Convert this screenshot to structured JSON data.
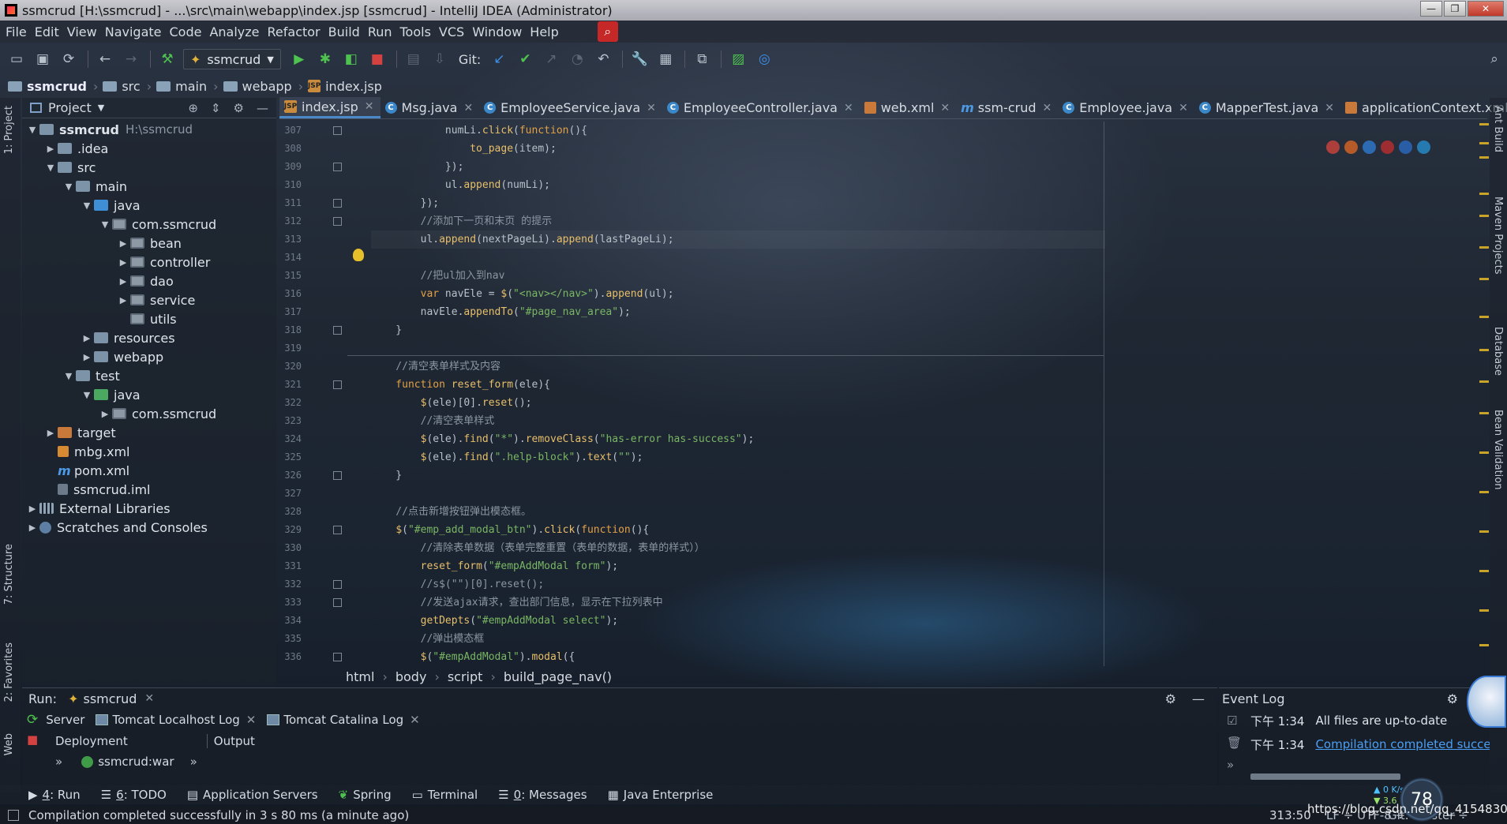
{
  "window": {
    "title": "ssmcrud [H:\\ssmcrud] - ...\\src\\main\\webapp\\index.jsp [ssmcrud] - IntelliJ IDEA (Administrator)",
    "minimize": "—",
    "maximize": "❐",
    "close": "✕"
  },
  "menu": [
    "File",
    "Edit",
    "View",
    "Navigate",
    "Code",
    "Analyze",
    "Refactor",
    "Build",
    "Run",
    "Tools",
    "VCS",
    "Window",
    "Help"
  ],
  "toolbar": {
    "run_config": "ssmcrud",
    "git_label": "Git:"
  },
  "breadcrumb": [
    "ssmcrud",
    "src",
    "main",
    "webapp",
    "index.jsp"
  ],
  "left_stripe": {
    "project": "1: Project",
    "structure": "7: Structure",
    "favorites": "2: Favorites",
    "web": "Web"
  },
  "right_stripe": {
    "ant": "Ant Build",
    "maven": "Maven Projects",
    "database": "Database",
    "bean": "Bean Validation"
  },
  "project_panel": {
    "title": "Project",
    "tree": [
      {
        "label": "ssmcrud",
        "extra": "H:\\ssmcrud",
        "level": 0,
        "arrow": "▼",
        "icon": "folder"
      },
      {
        "label": ".idea",
        "level": 1,
        "arrow": "▶",
        "icon": "folder"
      },
      {
        "label": "src",
        "level": 1,
        "arrow": "▼",
        "icon": "folder"
      },
      {
        "label": "main",
        "level": 2,
        "arrow": "▼",
        "icon": "folder"
      },
      {
        "label": "java",
        "level": 3,
        "arrow": "▼",
        "icon": "folder-blue"
      },
      {
        "label": "com.ssmcrud",
        "level": 4,
        "arrow": "▼",
        "icon": "pkg"
      },
      {
        "label": "bean",
        "level": 5,
        "arrow": "▶",
        "icon": "pkg"
      },
      {
        "label": "controller",
        "level": 5,
        "arrow": "▶",
        "icon": "pkg"
      },
      {
        "label": "dao",
        "level": 5,
        "arrow": "▶",
        "icon": "pkg"
      },
      {
        "label": "service",
        "level": 5,
        "arrow": "▶",
        "icon": "pkg"
      },
      {
        "label": "utils",
        "level": 5,
        "arrow": "",
        "icon": "pkg"
      },
      {
        "label": "resources",
        "level": 3,
        "arrow": "▶",
        "icon": "folder"
      },
      {
        "label": "webapp",
        "level": 3,
        "arrow": "▶",
        "icon": "folder"
      },
      {
        "label": "test",
        "level": 2,
        "arrow": "▼",
        "icon": "folder"
      },
      {
        "label": "java",
        "level": 3,
        "arrow": "▼",
        "icon": "folder-green"
      },
      {
        "label": "com.ssmcrud",
        "level": 4,
        "arrow": "▶",
        "icon": "pkg"
      },
      {
        "label": "target",
        "level": 1,
        "arrow": "▶",
        "icon": "folder-orange"
      },
      {
        "label": "mbg.xml",
        "level": 1,
        "arrow": "",
        "icon": "xml"
      },
      {
        "label": "pom.xml",
        "level": 1,
        "arrow": "",
        "icon": "mvn"
      },
      {
        "label": "ssmcrud.iml",
        "level": 1,
        "arrow": "",
        "icon": "iml"
      },
      {
        "label": "External Libraries",
        "level": 0,
        "arrow": "▶",
        "icon": "libs"
      },
      {
        "label": "Scratches and Consoles",
        "level": 0,
        "arrow": "▶",
        "icon": "scratch"
      }
    ]
  },
  "editor_tabs": [
    {
      "label": "index.jsp",
      "icon": "jsp",
      "active": true
    },
    {
      "label": "Msg.java",
      "icon": "c"
    },
    {
      "label": "EmployeeService.java",
      "icon": "c"
    },
    {
      "label": "EmployeeController.java",
      "icon": "c"
    },
    {
      "label": "web.xml",
      "icon": "x"
    },
    {
      "label": "ssm-crud",
      "icon": "m"
    },
    {
      "label": "Employee.java",
      "icon": "c"
    },
    {
      "label": "MapperTest.java",
      "icon": "c"
    },
    {
      "label": "applicationContext.xml",
      "icon": "x"
    }
  ],
  "code": {
    "first_line": 307,
    "current_line": 313,
    "lines": [
      [
        [
          "",
          "            numLi."
        ],
        [
          "fn",
          "click"
        ],
        [
          "",
          "("
        ],
        [
          "kw",
          "function"
        ],
        [
          "",
          "(){"
        ]
      ],
      [
        [
          "",
          "                "
        ],
        [
          "fn",
          "to_page"
        ],
        [
          "",
          "(item);"
        ]
      ],
      [
        [
          "",
          "            });"
        ]
      ],
      [
        [
          "",
          "            ul."
        ],
        [
          "fn",
          "append"
        ],
        [
          "",
          "(numLi);"
        ]
      ],
      [
        [
          "",
          "        });"
        ]
      ],
      [
        [
          "cm",
          "        //添加下一页和末页 的提示"
        ]
      ],
      [
        [
          "",
          "        ul."
        ],
        [
          "fn",
          "append"
        ],
        [
          "",
          "(nextPageLi)."
        ],
        [
          "fn",
          "append"
        ],
        [
          "",
          "(lastPageLi);"
        ]
      ],
      [
        [
          "",
          ""
        ]
      ],
      [
        [
          "cm",
          "        //把ul加入到nav"
        ]
      ],
      [
        [
          "",
          "        "
        ],
        [
          "kw",
          "var"
        ],
        [
          "",
          " navEle = "
        ],
        [
          "fn",
          "$"
        ],
        [
          "",
          "("
        ],
        [
          "str",
          "\"<nav></nav>\""
        ],
        [
          "",
          ")."
        ],
        [
          "fn",
          "append"
        ],
        [
          "",
          "(ul);"
        ]
      ],
      [
        [
          "",
          "        navEle."
        ],
        [
          "fn",
          "appendTo"
        ],
        [
          "",
          "("
        ],
        [
          "str",
          "\"#page_nav_area\""
        ],
        [
          "",
          ");"
        ]
      ],
      [
        [
          "",
          "    }"
        ]
      ],
      [
        [
          "",
          ""
        ]
      ],
      [
        [
          "cm",
          "    //清空表单样式及内容"
        ]
      ],
      [
        [
          "kw",
          "    function"
        ],
        [
          "",
          " "
        ],
        [
          "fn",
          "reset_form"
        ],
        [
          "",
          "(ele){"
        ]
      ],
      [
        [
          "",
          "        "
        ],
        [
          "fn",
          "$"
        ],
        [
          "",
          "(ele)[0]."
        ],
        [
          "fn",
          "reset"
        ],
        [
          "",
          "();"
        ]
      ],
      [
        [
          "cm",
          "        //清空表单样式"
        ]
      ],
      [
        [
          "",
          "        "
        ],
        [
          "fn",
          "$"
        ],
        [
          "",
          "(ele)."
        ],
        [
          "fn",
          "find"
        ],
        [
          "",
          "("
        ],
        [
          "str",
          "\"*\""
        ],
        [
          "",
          ")."
        ],
        [
          "fn",
          "removeClass"
        ],
        [
          "",
          "("
        ],
        [
          "str",
          "\"has-error has-success\""
        ],
        [
          "",
          ");"
        ]
      ],
      [
        [
          "",
          "        "
        ],
        [
          "fn",
          "$"
        ],
        [
          "",
          "(ele)."
        ],
        [
          "fn",
          "find"
        ],
        [
          "",
          "("
        ],
        [
          "str",
          "\".help-block\""
        ],
        [
          "",
          ")."
        ],
        [
          "fn",
          "text"
        ],
        [
          "",
          "("
        ],
        [
          "str",
          "\"\""
        ],
        [
          "",
          ");"
        ]
      ],
      [
        [
          "",
          "    }"
        ]
      ],
      [
        [
          "",
          ""
        ]
      ],
      [
        [
          "cm",
          "    //点击新增按钮弹出模态框。"
        ]
      ],
      [
        [
          "",
          "    "
        ],
        [
          "fn",
          "$"
        ],
        [
          "",
          "("
        ],
        [
          "str",
          "\"#emp_add_modal_btn\""
        ],
        [
          "",
          ")."
        ],
        [
          "fn",
          "click"
        ],
        [
          "",
          "("
        ],
        [
          "kw",
          "function"
        ],
        [
          "",
          "(){"
        ]
      ],
      [
        [
          "cm",
          "        //清除表单数据（表单完整重置（表单的数据，表单的样式））"
        ]
      ],
      [
        [
          "",
          "        "
        ],
        [
          "fn",
          "reset_form"
        ],
        [
          "",
          "("
        ],
        [
          "str",
          "\"#empAddModal form\""
        ],
        [
          "",
          ");"
        ]
      ],
      [
        [
          "cm",
          "        //s$(\"\")[0].reset();"
        ]
      ],
      [
        [
          "cm",
          "        //发送ajax请求，查出部门信息，显示在下拉列表中"
        ]
      ],
      [
        [
          "",
          "        "
        ],
        [
          "fn",
          "getDepts"
        ],
        [
          "",
          "("
        ],
        [
          "str",
          "\"#empAddModal select\""
        ],
        [
          "",
          ");"
        ]
      ],
      [
        [
          "cm",
          "        //弹出模态框"
        ]
      ],
      [
        [
          "",
          "        "
        ],
        [
          "fn",
          "$"
        ],
        [
          "",
          "("
        ],
        [
          "str",
          "\"#empAddModal\""
        ],
        [
          "",
          ")."
        ],
        [
          "fn",
          "modal"
        ],
        [
          "",
          "({"
        ]
      ]
    ]
  },
  "editor_breadcrumb": [
    "html",
    "body",
    "script",
    "build_page_nav()"
  ],
  "run_panel": {
    "title": "Run:",
    "config": "ssmcrud",
    "tabs": [
      "Server",
      "Tomcat Localhost Log",
      "Tomcat Catalina Log"
    ],
    "col_deployment": "Deployment",
    "col_output": "Output",
    "artifact": "ssmcrud:war"
  },
  "event_log": {
    "title": "Event Log",
    "entries": [
      {
        "time": "下午 1:34",
        "message": "All files are up-to-date",
        "link": false
      },
      {
        "time": "下午 1:34",
        "message": "Compilation completed succe",
        "link": true
      }
    ]
  },
  "tool_windows": [
    {
      "num": "4",
      "label": ": Run"
    },
    {
      "num": "6",
      "label": ": TODO"
    },
    {
      "num": "",
      "label": "Application Servers"
    },
    {
      "num": "",
      "label": "Spring"
    },
    {
      "num": "",
      "label": "Terminal"
    },
    {
      "num": "0",
      "label": ": Messages"
    },
    {
      "num": "",
      "label": "Java Enterprise"
    }
  ],
  "status": {
    "message": "Compilation completed successfully in 3 s 80 ms (a minute ago)",
    "position": "313:50",
    "encoding": "LF ÷  UTF-8 ÷",
    "git": "Git: master ÷"
  },
  "overlay": {
    "watermark": "https://blog.csdn.net/qq_41548307",
    "net_percent": "78",
    "net_up": "0 K/s",
    "net_down": "3.6"
  }
}
